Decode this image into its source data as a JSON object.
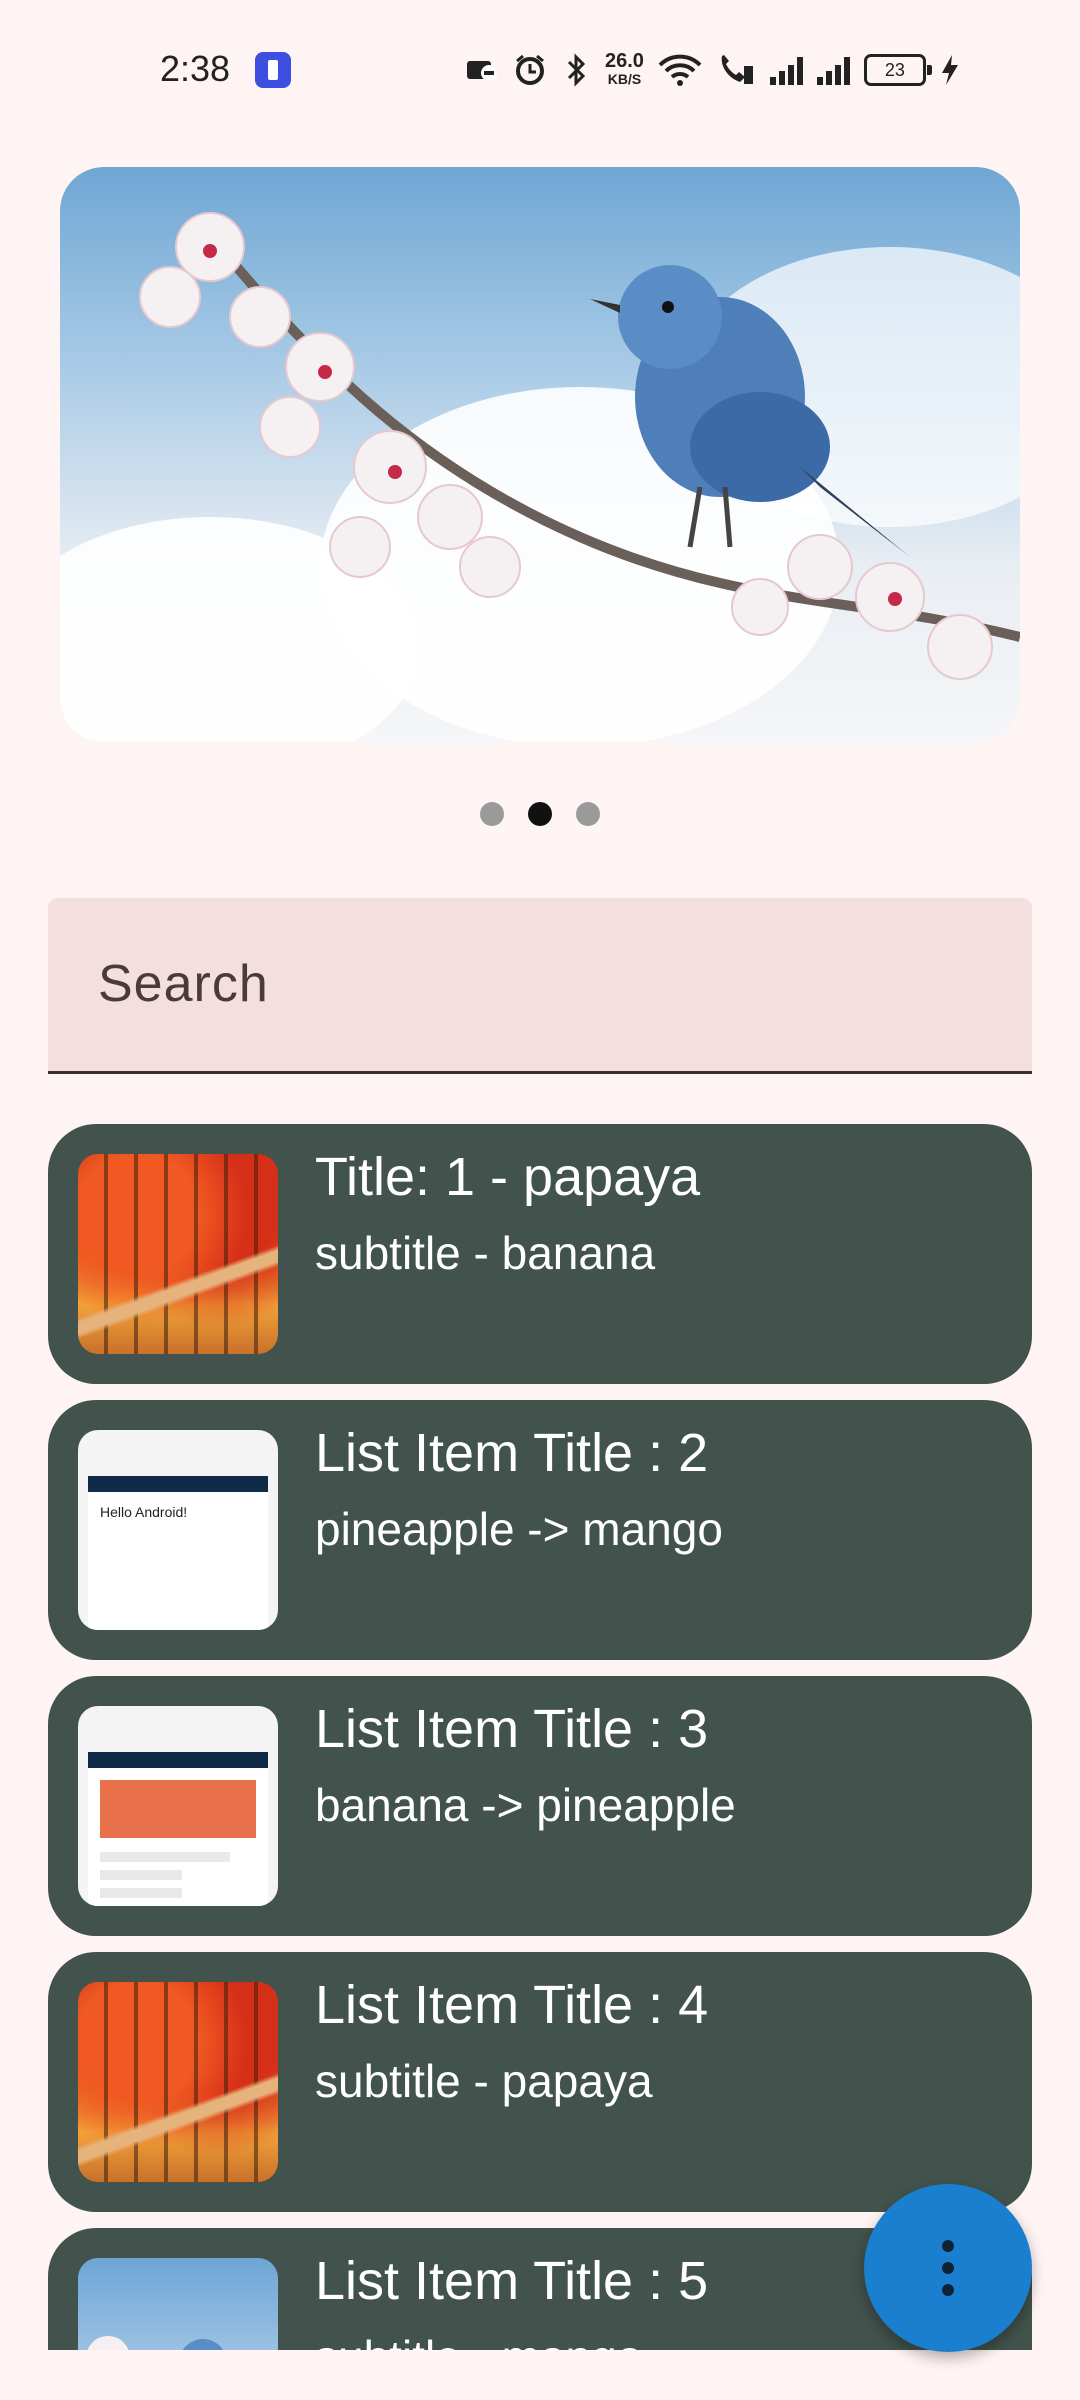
{
  "status_bar": {
    "time": "2:38",
    "network_speed_value": "26.0",
    "network_speed_unit": "KB/S",
    "battery_level": "23"
  },
  "carousel": {
    "pages": 3,
    "active_index": 1
  },
  "search": {
    "placeholder": "Search"
  },
  "list": {
    "items": [
      {
        "title": " Title: 1 - papaya",
        "subtitle": "subtitle - banana",
        "thumbnail": "autumn-forest"
      },
      {
        "title": "List Item Title : 2",
        "subtitle": "pineapple -> mango",
        "thumbnail": "phone-hello-android",
        "thumb_text": "Hello Android!"
      },
      {
        "title": "List Item Title : 3",
        "subtitle": "banana -> pineapple",
        "thumbnail": "phone-layout"
      },
      {
        "title": "List Item Title : 4",
        "subtitle": "subtitle - papaya",
        "thumbnail": "autumn-forest"
      },
      {
        "title": "List Item Title : 5",
        "subtitle": "subtitle - mango",
        "thumbnail": "blue-bird"
      }
    ]
  },
  "fab": {
    "icon": "more-vert-icon",
    "color": "#1b7fd0"
  },
  "colors": {
    "background": "#fff4f4",
    "card": "#42524d",
    "search_bg": "#f4dede"
  }
}
